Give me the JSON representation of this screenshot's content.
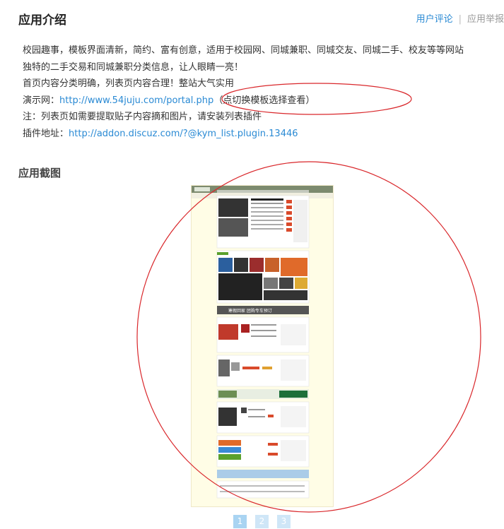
{
  "header": {
    "title": "应用介绍",
    "tab_review": "用户评论",
    "tab_separator": "|",
    "tab_report": "应用举报"
  },
  "intro": {
    "line1": "校园趣事，模板界面清新，简约、富有创意，适用于校园网、同城兼职、同城交友、同城二手、校友等等网站",
    "line2": "独特的二手交易和同城兼职分类信息，让人眼睛一亮！",
    "line3": "首页内容分类明确，列表页内容合理！整站大气实用",
    "demo_prefix": "演示网：",
    "demo_link": "http://www.54juju.com/portal.php",
    "demo_note": "（点切换模板选择查看）",
    "note": "注：列表页如需要提取贴子内容摘和图片，请安装列表插件",
    "plugin_prefix": "插件地址：",
    "plugin_link": "http://addon.discuz.com/?@kym_list.plugin.13446"
  },
  "screenshots": {
    "title": "应用截图",
    "banner_text": "寒假回家  团购专车预订",
    "pages": [
      "1",
      "2",
      "3"
    ],
    "active_page": "1"
  },
  "colors": {
    "link": "#2a8ad4",
    "annotation": "#d9262a",
    "screenshot_bg": "#fffde6"
  }
}
